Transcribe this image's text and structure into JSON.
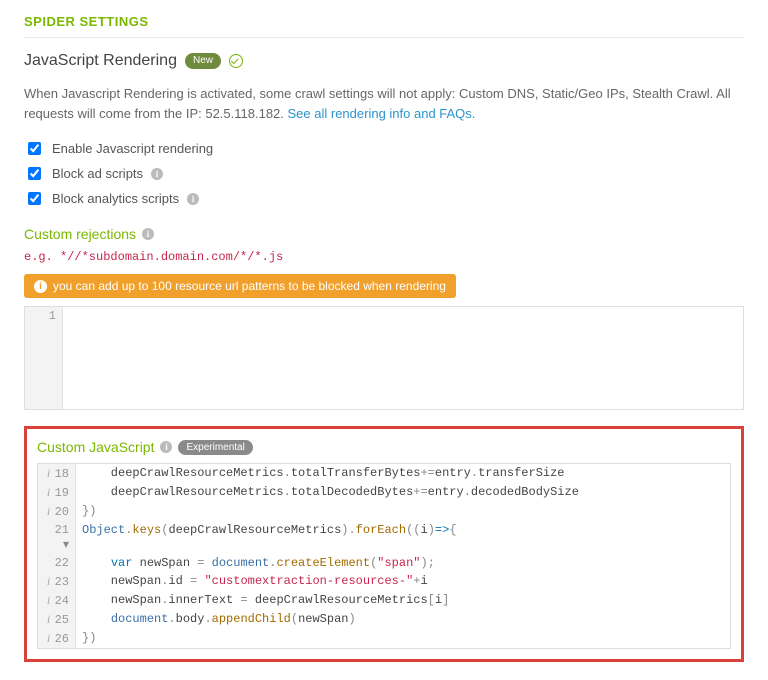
{
  "header": {
    "title": "SPIDER SETTINGS"
  },
  "subheader": {
    "title": "JavaScript Rendering",
    "badge": "New"
  },
  "intro": {
    "text": "When Javascript Rendering is activated, some crawl settings will not apply: Custom DNS, Static/Geo IPs, Stealth Crawl. All requests will come from the IP: 52.5.118.182. ",
    "link": "See all rendering info and FAQs."
  },
  "checkboxes": [
    {
      "label": "Enable Javascript rendering",
      "checked": true,
      "info": false
    },
    {
      "label": "Block ad scripts",
      "checked": true,
      "info": true
    },
    {
      "label": "Block analytics scripts",
      "checked": true,
      "info": true
    }
  ],
  "rejections": {
    "title": "Custom rejections",
    "example": "e.g. *//*subdomain.domain.com/*/*.js",
    "alert": "you can add up to 100 resource url patterns to be blocked when rendering",
    "editor": {
      "lines": [
        {
          "n": "1",
          "code": ""
        }
      ]
    }
  },
  "customjs": {
    "title": "Custom JavaScript",
    "badge": "Experimental",
    "lines": [
      {
        "bp": true,
        "n": "18",
        "fold": "",
        "seg": [
          {
            "c": "tok-plain",
            "t": "    deepCrawlResourceMetrics"
          },
          {
            "c": "tok-punc",
            "t": "."
          },
          {
            "c": "tok-plain",
            "t": "totalTransferBytes"
          },
          {
            "c": "tok-punc",
            "t": "+="
          },
          {
            "c": "tok-plain",
            "t": "entry"
          },
          {
            "c": "tok-punc",
            "t": "."
          },
          {
            "c": "tok-plain",
            "t": "transferSize"
          }
        ]
      },
      {
        "bp": true,
        "n": "19",
        "fold": "",
        "seg": [
          {
            "c": "tok-plain",
            "t": "    deepCrawlResourceMetrics"
          },
          {
            "c": "tok-punc",
            "t": "."
          },
          {
            "c": "tok-plain",
            "t": "totalDecodedBytes"
          },
          {
            "c": "tok-punc",
            "t": "+="
          },
          {
            "c": "tok-plain",
            "t": "entry"
          },
          {
            "c": "tok-punc",
            "t": "."
          },
          {
            "c": "tok-plain",
            "t": "decodedBodySize"
          }
        ]
      },
      {
        "bp": true,
        "n": "20",
        "fold": "",
        "seg": [
          {
            "c": "tok-punc",
            "t": "})"
          }
        ]
      },
      {
        "bp": false,
        "n": "21",
        "fold": "▾",
        "seg": [
          {
            "c": "tok-obj",
            "t": "Object"
          },
          {
            "c": "tok-punc",
            "t": "."
          },
          {
            "c": "tok-func",
            "t": "keys"
          },
          {
            "c": "tok-punc",
            "t": "("
          },
          {
            "c": "tok-plain",
            "t": "deepCrawlResourceMetrics"
          },
          {
            "c": "tok-punc",
            "t": ")."
          },
          {
            "c": "tok-func",
            "t": "forEach"
          },
          {
            "c": "tok-punc",
            "t": "(("
          },
          {
            "c": "tok-plain",
            "t": "i"
          },
          {
            "c": "tok-punc",
            "t": ")"
          },
          {
            "c": "tok-key",
            "t": "=>"
          },
          {
            "c": "tok-punc",
            "t": "{"
          }
        ]
      },
      {
        "bp": false,
        "n": "22",
        "fold": "",
        "seg": [
          {
            "c": "tok-plain",
            "t": "    "
          },
          {
            "c": "tok-key",
            "t": "var"
          },
          {
            "c": "tok-plain",
            "t": " newSpan "
          },
          {
            "c": "tok-punc",
            "t": "= "
          },
          {
            "c": "tok-var",
            "t": "document"
          },
          {
            "c": "tok-punc",
            "t": "."
          },
          {
            "c": "tok-func",
            "t": "createElement"
          },
          {
            "c": "tok-punc",
            "t": "("
          },
          {
            "c": "tok-str",
            "t": "\"span\""
          },
          {
            "c": "tok-punc",
            "t": ");"
          }
        ]
      },
      {
        "bp": true,
        "n": "23",
        "fold": "",
        "seg": [
          {
            "c": "tok-plain",
            "t": "    newSpan"
          },
          {
            "c": "tok-punc",
            "t": "."
          },
          {
            "c": "tok-plain",
            "t": "id "
          },
          {
            "c": "tok-punc",
            "t": "= "
          },
          {
            "c": "tok-str",
            "t": "\"customextraction-resources-\""
          },
          {
            "c": "tok-punc",
            "t": "+"
          },
          {
            "c": "tok-plain",
            "t": "i"
          }
        ]
      },
      {
        "bp": true,
        "n": "24",
        "fold": "",
        "seg": [
          {
            "c": "tok-plain",
            "t": "    newSpan"
          },
          {
            "c": "tok-punc",
            "t": "."
          },
          {
            "c": "tok-plain",
            "t": "innerText "
          },
          {
            "c": "tok-punc",
            "t": "= "
          },
          {
            "c": "tok-plain",
            "t": "deepCrawlResourceMetrics"
          },
          {
            "c": "tok-punc",
            "t": "["
          },
          {
            "c": "tok-plain",
            "t": "i"
          },
          {
            "c": "tok-punc",
            "t": "]"
          }
        ]
      },
      {
        "bp": true,
        "n": "25",
        "fold": "",
        "seg": [
          {
            "c": "tok-plain",
            "t": "    "
          },
          {
            "c": "tok-var",
            "t": "document"
          },
          {
            "c": "tok-punc",
            "t": "."
          },
          {
            "c": "tok-plain",
            "t": "body"
          },
          {
            "c": "tok-punc",
            "t": "."
          },
          {
            "c": "tok-func",
            "t": "appendChild"
          },
          {
            "c": "tok-punc",
            "t": "("
          },
          {
            "c": "tok-plain",
            "t": "newSpan"
          },
          {
            "c": "tok-punc",
            "t": ")"
          }
        ]
      },
      {
        "bp": true,
        "n": "26",
        "fold": "",
        "seg": [
          {
            "c": "tok-punc",
            "t": "})"
          }
        ]
      }
    ]
  }
}
